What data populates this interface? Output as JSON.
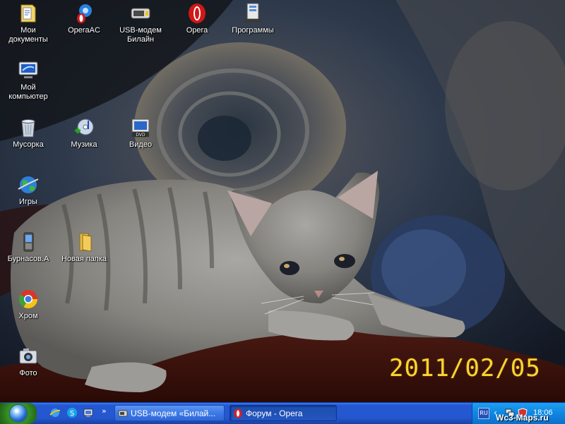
{
  "desktop": {
    "photo_date": "2011/02/05",
    "icons": [
      {
        "label": "Мои документы",
        "icon": "my-documents-icon"
      },
      {
        "label": "OperaAC",
        "icon": "operaac-icon"
      },
      {
        "label": "USB-модем Билайн",
        "icon": "usb-modem-icon"
      },
      {
        "label": "Opera",
        "icon": "opera-icon"
      },
      {
        "label": "Программы",
        "icon": "programs-icon"
      },
      {
        "label": "Мой компьютер",
        "icon": "my-computer-icon"
      },
      {
        "label": "Мусорка",
        "icon": "recycle-bin-icon"
      },
      {
        "label": "Музика",
        "icon": "music-icon"
      },
      {
        "label": "Видео",
        "icon": "video-icon"
      },
      {
        "label": "Игры",
        "icon": "games-globe-icon"
      },
      {
        "label": "Бурнасов.А",
        "icon": "phone-icon"
      },
      {
        "label": "Новая папка",
        "icon": "folder-icon"
      },
      {
        "label": "Хром",
        "icon": "chrome-icon"
      },
      {
        "label": "Фото",
        "icon": "camera-icon"
      }
    ]
  },
  "taskbar": {
    "quick_launch": [
      "ie-icon",
      "skype-icon",
      "desktop-icon"
    ],
    "quick_launch_more": "»",
    "tasks": [
      {
        "label": "USB-модем «Билай...",
        "icon": "usb-modem-icon",
        "active": false
      },
      {
        "label": "Форум - Opera",
        "icon": "opera-icon",
        "active": true
      }
    ],
    "tray": {
      "language": "RU",
      "expand": "‹",
      "time": "18:06"
    }
  },
  "watermark": "Wc3-Maps.ru",
  "colors": {
    "taskbar_blue": "#2458d2",
    "start_green": "#3f9d2d",
    "date_yellow": "#ffd430"
  }
}
